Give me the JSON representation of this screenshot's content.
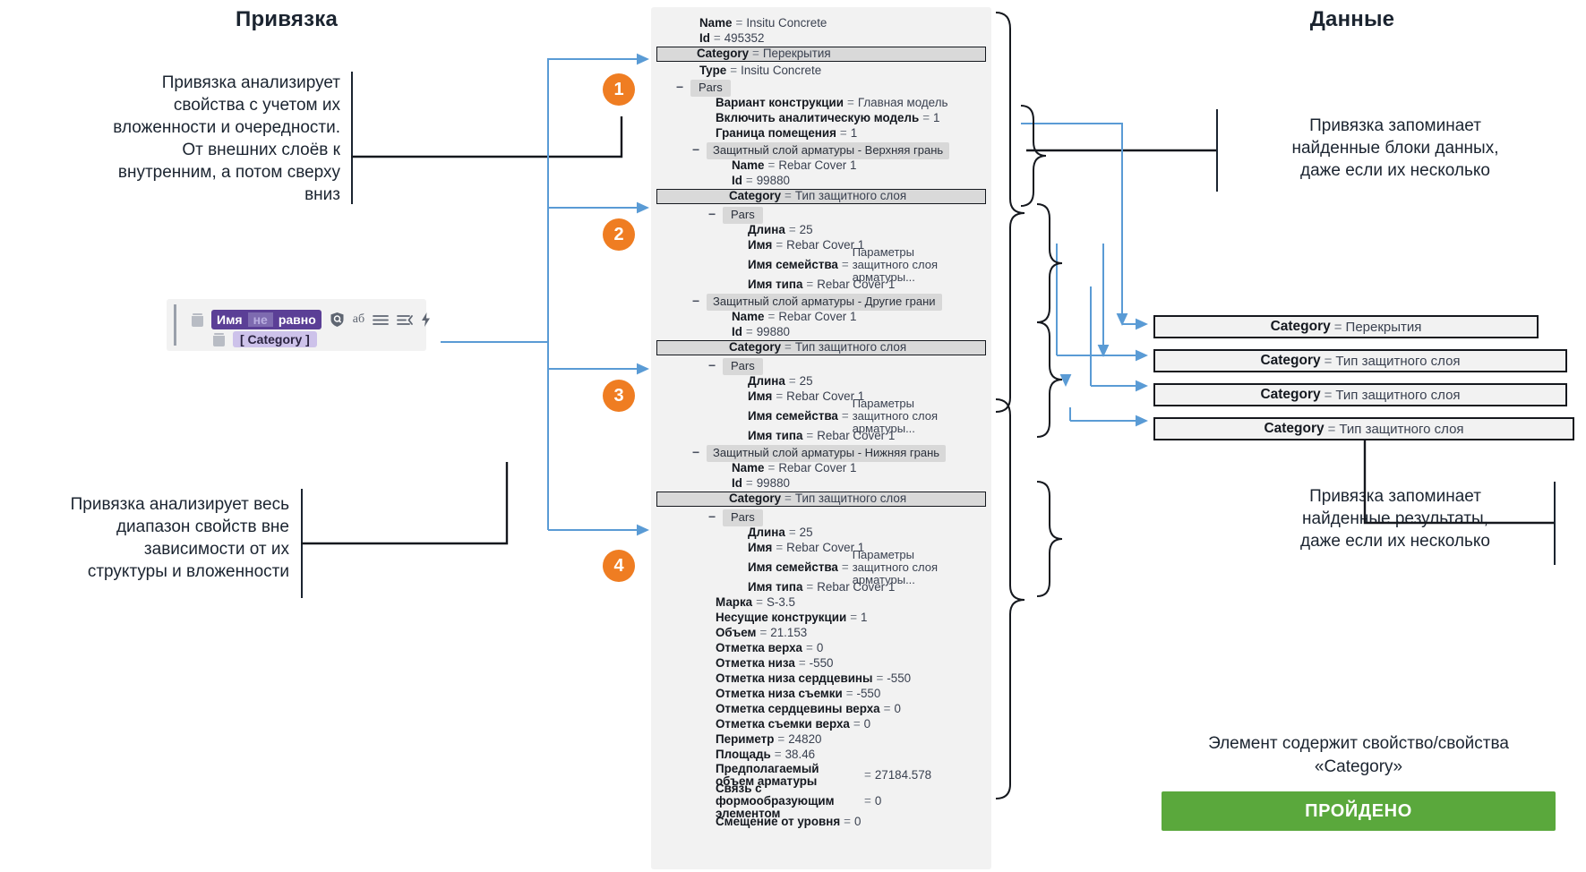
{
  "headings": {
    "left": "Привязка",
    "right": "Данные"
  },
  "notes": {
    "top_left": "Привязка анализирует\nсвойства с учетом их\nвложенности и очередности.\nОт внешних слоёв к\nвнутренним, а потом сверху\nвниз",
    "bottom_left": "Привязка анализирует весь\nдиапазон свойств вне\nзависимости от их\nструктуры и вложенности",
    "top_right": "Привязка запоминает\nнайденные блоки данных,\nдаже если их несколько",
    "bottom_right": "Привязка запоминает\nнайденные результаты,\nдаже если их несколько"
  },
  "filter_widget": {
    "delete_icon": "trash-icon",
    "condition": {
      "field": "Имя",
      "negation": "не",
      "operator": "равно"
    },
    "icons": [
      "shield-search-icon",
      "case-text-icon",
      "list-icon",
      "list-collapse-icon",
      "lightning-icon"
    ],
    "value_chip": "[ Category ]",
    "value_delete_icon": "trash-icon"
  },
  "badges": [
    "1",
    "2",
    "3",
    "4"
  ],
  "tree": {
    "rows": [
      {
        "type": "prop",
        "indent": 0,
        "key": "Name",
        "value": "Insitu Concrete"
      },
      {
        "type": "prop",
        "indent": 0,
        "key": "Id",
        "value": "495352"
      },
      {
        "type": "prop",
        "indent": 0,
        "key": "Category",
        "value": "Перекрытия",
        "highlight": true
      },
      {
        "type": "prop",
        "indent": 0,
        "key": "Type",
        "value": "Insitu Concrete"
      },
      {
        "type": "group",
        "indent": 0,
        "label": "Pars",
        "collapse": "−"
      },
      {
        "type": "prop",
        "indent": 1,
        "key": "Вариант конструкции",
        "value": "Главная модель"
      },
      {
        "type": "prop",
        "indent": 1,
        "key": "Включить аналитическую модель",
        "value": "1"
      },
      {
        "type": "prop",
        "indent": 1,
        "key": "Граница помещения",
        "value": "1"
      },
      {
        "type": "group",
        "indent": 1,
        "label": "Защитный слой арматуры - Верхняя грань",
        "collapse": "−"
      },
      {
        "type": "prop",
        "indent": 2,
        "key": "Name",
        "value": "Rebar Cover 1"
      },
      {
        "type": "prop",
        "indent": 2,
        "key": "Id",
        "value": "99880"
      },
      {
        "type": "prop",
        "indent": 2,
        "key": "Category",
        "value": "Тип защитного слоя",
        "highlight": true
      },
      {
        "type": "group",
        "indent": 2,
        "label": "Pars",
        "collapse": "−"
      },
      {
        "type": "prop",
        "indent": 3,
        "key": "Длина",
        "value": "25"
      },
      {
        "type": "prop",
        "indent": 3,
        "key": "Имя",
        "value": "Rebar Cover 1"
      },
      {
        "type": "prop",
        "indent": 3,
        "key": "Имя семейства",
        "value": "Параметры защитного слоя арматуры...",
        "wrap": true
      },
      {
        "type": "prop",
        "indent": 3,
        "key": "Имя типа",
        "value": "Rebar Cover 1"
      },
      {
        "type": "group",
        "indent": 1,
        "label": "Защитный слой арматуры - Другие грани",
        "collapse": "−"
      },
      {
        "type": "prop",
        "indent": 2,
        "key": "Name",
        "value": "Rebar Cover 1"
      },
      {
        "type": "prop",
        "indent": 2,
        "key": "Id",
        "value": "99880"
      },
      {
        "type": "prop",
        "indent": 2,
        "key": "Category",
        "value": "Тип защитного слоя",
        "highlight": true
      },
      {
        "type": "group",
        "indent": 2,
        "label": "Pars",
        "collapse": "−"
      },
      {
        "type": "prop",
        "indent": 3,
        "key": "Длина",
        "value": "25"
      },
      {
        "type": "prop",
        "indent": 3,
        "key": "Имя",
        "value": "Rebar Cover 1"
      },
      {
        "type": "prop",
        "indent": 3,
        "key": "Имя семейства",
        "value": "Параметры защитного слоя арматуры...",
        "wrap": true
      },
      {
        "type": "prop",
        "indent": 3,
        "key": "Имя типа",
        "value": "Rebar Cover 1"
      },
      {
        "type": "group",
        "indent": 1,
        "label": "Защитный слой арматуры - Нижняя грань",
        "collapse": "−"
      },
      {
        "type": "prop",
        "indent": 2,
        "key": "Name",
        "value": "Rebar Cover 1"
      },
      {
        "type": "prop",
        "indent": 2,
        "key": "Id",
        "value": "99880"
      },
      {
        "type": "prop",
        "indent": 2,
        "key": "Category",
        "value": "Тип защитного слоя",
        "highlight": true
      },
      {
        "type": "group",
        "indent": 2,
        "label": "Pars",
        "collapse": "−"
      },
      {
        "type": "prop",
        "indent": 3,
        "key": "Длина",
        "value": "25"
      },
      {
        "type": "prop",
        "indent": 3,
        "key": "Имя",
        "value": "Rebar Cover 1"
      },
      {
        "type": "prop",
        "indent": 3,
        "key": "Имя семейства",
        "value": "Параметры защитного слоя арматуры...",
        "wrap": true
      },
      {
        "type": "prop",
        "indent": 3,
        "key": "Имя типа",
        "value": "Rebar Cover 1"
      },
      {
        "type": "prop",
        "indent": 1,
        "key": "Марка",
        "value": "S-3.5"
      },
      {
        "type": "prop",
        "indent": 1,
        "key": "Несущие конструкции",
        "value": "1"
      },
      {
        "type": "prop",
        "indent": 1,
        "key": "Объем",
        "value": "21.153"
      },
      {
        "type": "prop",
        "indent": 1,
        "key": "Отметка верха",
        "value": "0"
      },
      {
        "type": "prop",
        "indent": 1,
        "key": "Отметка низа",
        "value": "-550"
      },
      {
        "type": "prop",
        "indent": 1,
        "key": "Отметка низа сердцевины",
        "value": "-550"
      },
      {
        "type": "prop",
        "indent": 1,
        "key": "Отметка низа съемки",
        "value": "-550"
      },
      {
        "type": "prop",
        "indent": 1,
        "key": "Отметка сердцевины верха",
        "value": "0"
      },
      {
        "type": "prop",
        "indent": 1,
        "key": "Отметка съемки верха",
        "value": "0"
      },
      {
        "type": "prop",
        "indent": 1,
        "key": "Периметр",
        "value": "24820"
      },
      {
        "type": "prop",
        "indent": 1,
        "key": "Площадь",
        "value": "38.46"
      },
      {
        "type": "prop",
        "indent": 1,
        "key": "Предполагаемый объем арматуры",
        "value": "27184.578",
        "wrapkey": true
      },
      {
        "type": "prop",
        "indent": 1,
        "key": "Связь с формообразующим элементом",
        "value": "0",
        "wrapkey": true
      },
      {
        "type": "prop",
        "indent": 1,
        "key": "Смещение от уровня",
        "value": "0"
      }
    ]
  },
  "results": [
    {
      "key": "Category",
      "value": "Перекрытия"
    },
    {
      "key": "Category",
      "value": "Тип защитного слоя"
    },
    {
      "key": "Category",
      "value": "Тип защитного слоя"
    },
    {
      "key": "Category",
      "value": "Тип защитного слоя"
    }
  ],
  "pass": {
    "caption": "Элемент содержит свойство/свойства\n«Category»",
    "label": "ПРОЙДЕНО",
    "color": "#5aa83c"
  },
  "colors": {
    "accent_orange": "#ef7d22",
    "arrow_blue": "#5a9bd5",
    "panel_grey": "#f2f2f2",
    "chip_grey": "#d8d8d8",
    "purple": "#5b3f96",
    "purple_light": "#cdc2ea",
    "green": "#5aa83c"
  }
}
